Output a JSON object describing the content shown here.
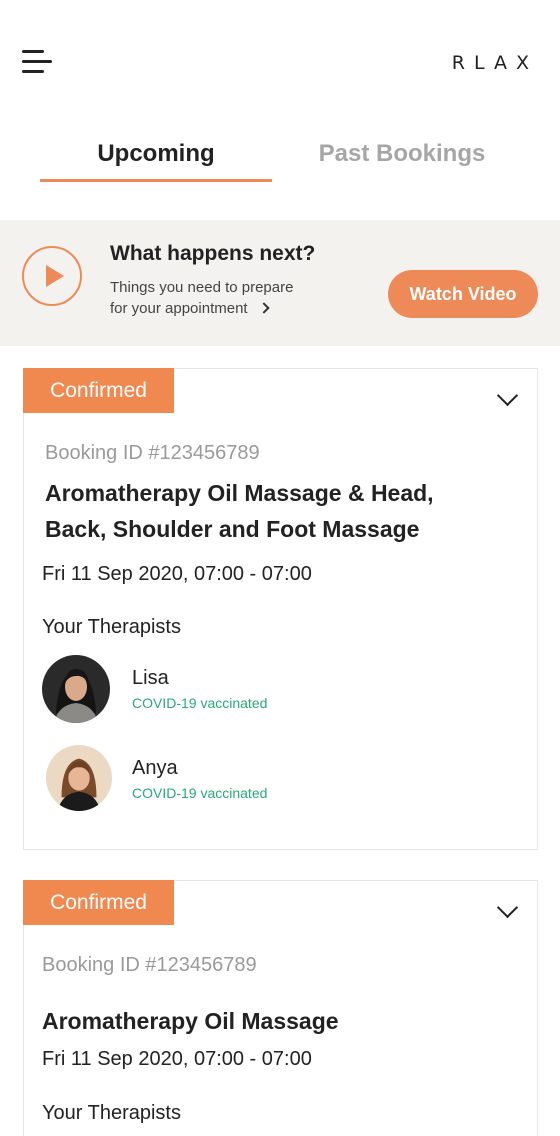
{
  "header": {
    "logo": "RLAX"
  },
  "tabs": [
    {
      "label": "Upcoming",
      "active": true
    },
    {
      "label": "Past Bookings",
      "active": false
    }
  ],
  "banner": {
    "title": "What happens next?",
    "subtitle_line1": "Things you need to prepare",
    "subtitle_line2": "for your appointment",
    "button_label": "Watch Video"
  },
  "colors": {
    "accent": "#ee8a57",
    "vaccinated_text": "#2aa876"
  },
  "bookings": [
    {
      "status": "Confirmed",
      "booking_id": "Booking ID #123456789",
      "service_line1": "Aromatherapy Oil Massage & Head,",
      "service_line2": "Back, Shoulder and Foot Massage",
      "datetime": "Fri 11 Sep 2020, 07:00 - 07:00",
      "therapists_heading": "Your Therapists",
      "therapists": [
        {
          "name": "Lisa",
          "vaccination": "COVID-19 vaccinated"
        },
        {
          "name": "Anya",
          "vaccination": "COVID-19 vaccinated"
        }
      ]
    },
    {
      "status": "Confirmed",
      "booking_id": "Booking ID #123456789",
      "service_line1": "Aromatherapy Oil Massage",
      "datetime": "Fri 11 Sep 2020, 07:00 - 07:00",
      "therapists_heading": "Your Therapists"
    }
  ]
}
